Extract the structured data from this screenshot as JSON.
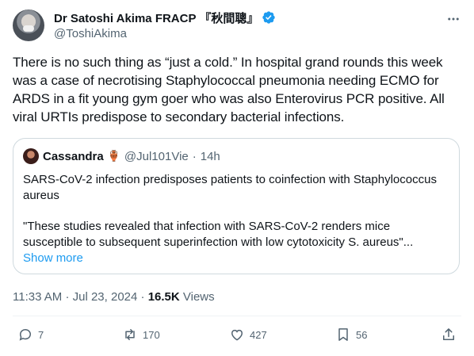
{
  "author": {
    "display_name": "Dr Satoshi Akima FRACP 『秋間聰』",
    "handle": "@ToshiAkima",
    "verified": true
  },
  "post": {
    "text": "There is no such thing as “just a cold.” In hospital grand rounds this week was a case of necrotising Staphylococcal pneumonia needing ECMO for ARDS in a fit young gym goer who was also Enterovirus PCR positive. All viral URTIs predispose to secondary bacterial infections."
  },
  "quoted_post": {
    "display_name": "Cassandra",
    "emoji": "🏺",
    "handle": "@Jul101Vie",
    "separator": "·",
    "time": "14h",
    "text": "SARS-CoV-2 infection predisposes patients to coinfection with Staphylococcus aureus",
    "text2": "\"These studies revealed that infection with SARS-CoV-2 renders mice susceptible to subsequent superinfection with low cytotoxicity S. aureus\"...",
    "show_more": "Show more"
  },
  "meta": {
    "time": "11:33 AM",
    "separator": "·",
    "date": "Jul 23, 2024",
    "views_count": "16.5K",
    "views_label": "Views"
  },
  "actions": {
    "replies": "7",
    "reposts": "170",
    "likes": "427",
    "bookmarks": "56"
  },
  "colors": {
    "accent": "#1d9bf0",
    "text_primary": "#0f1419",
    "text_secondary": "#536471",
    "border": "#cfd9de"
  },
  "icons": [
    "verified-badge-icon",
    "more-icon",
    "reply-icon",
    "repost-icon",
    "like-icon",
    "bookmark-icon",
    "share-icon"
  ]
}
